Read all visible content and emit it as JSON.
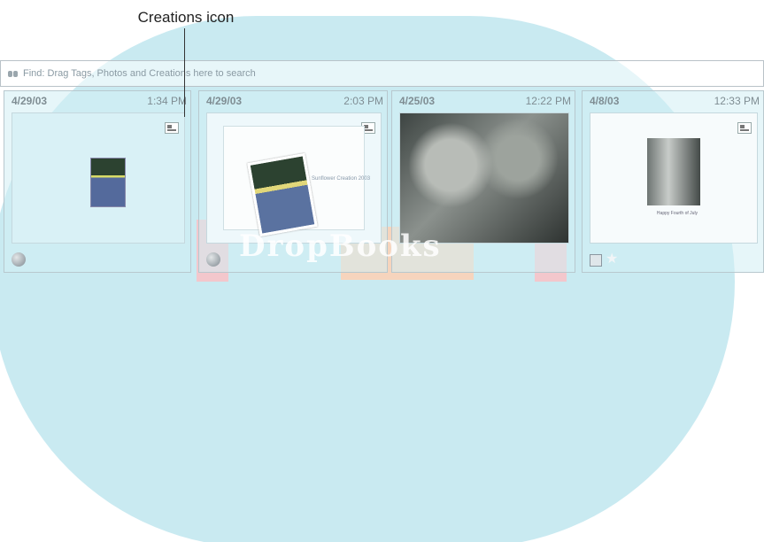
{
  "annotation": {
    "callout": "Creations icon"
  },
  "find_bar": {
    "text": "Find: Drag Tags, Photos and Creations here to search"
  },
  "cards": [
    {
      "date": "4/29/03",
      "time": "1:34 PM",
      "icon": "globe"
    },
    {
      "date": "4/29/03",
      "time": "2:03 PM",
      "icon": "globe",
      "caption": "Sunflower Creation 2003"
    },
    {
      "date": "4/25/03",
      "time": "12:22 PM"
    },
    {
      "date": "4/8/03",
      "time": "12:33 PM",
      "icons": [
        "people-tag",
        "star"
      ],
      "caption": "Happy Fourth of July"
    }
  ],
  "watermark": "DropBooks",
  "colors": {
    "background_arch": "#c9eaf1",
    "card_tint": "#d2eef4",
    "text_gray": "#7f8d93"
  }
}
